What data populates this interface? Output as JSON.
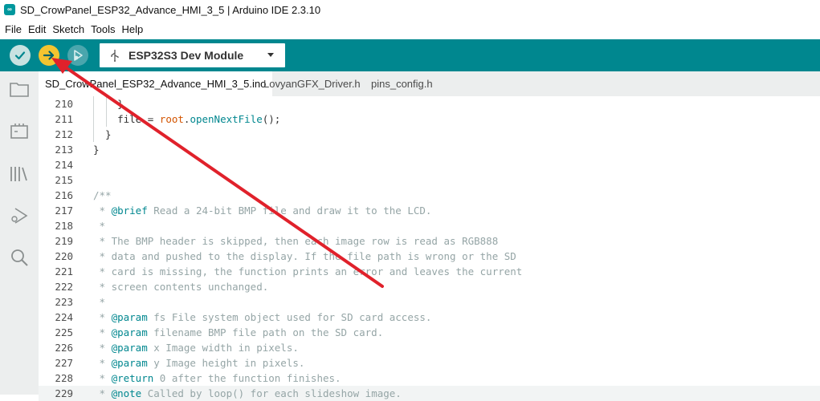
{
  "window": {
    "title": "SD_CrowPanel_ESP32_Advance_HMI_3_5 | Arduino IDE 2.3.10"
  },
  "menu": [
    {
      "label": "File"
    },
    {
      "label": "Edit"
    },
    {
      "label": "Sketch"
    },
    {
      "label": "Tools"
    },
    {
      "label": "Help"
    }
  ],
  "toolbar": {
    "verify_icon": "check-icon",
    "upload_icon": "arrow-right-icon",
    "debug_icon": "debug-icon",
    "board": "ESP32S3 Dev Module",
    "colors": {
      "toolbar_bg": "#00878f",
      "upload": "#f4c430"
    }
  },
  "sidebar": [
    {
      "icon": "folder-icon"
    },
    {
      "icon": "board-icon"
    },
    {
      "icon": "library-icon"
    },
    {
      "icon": "debug-icon"
    },
    {
      "icon": "search-icon"
    }
  ],
  "tabs": [
    {
      "label": "SD_CrowPanel_ESP32_Advance_HMI_3_5.ino",
      "active": true
    },
    {
      "label": "LovyanGFX_Driver.h",
      "active": false
    },
    {
      "label": "pins_config.h",
      "active": false
    }
  ],
  "code_lines": [
    {
      "n": "210",
      "text": "    }"
    },
    {
      "n": "211",
      "text": "    file = root.openNextFile();"
    },
    {
      "n": "212",
      "text": "  }"
    },
    {
      "n": "213",
      "text": "}"
    },
    {
      "n": "214",
      "text": ""
    },
    {
      "n": "215",
      "text": ""
    },
    {
      "n": "216",
      "text": "/**"
    },
    {
      "n": "217",
      "text": " * @brief Read a 24-bit BMP file and draw it to the LCD."
    },
    {
      "n": "218",
      "text": " *"
    },
    {
      "n": "219",
      "text": " * The BMP header is skipped, then each image row is read as RGB888"
    },
    {
      "n": "220",
      "text": " * data and pushed to the display. If the file path is wrong or the SD"
    },
    {
      "n": "221",
      "text": " * card is missing, the function prints an error and leaves the current"
    },
    {
      "n": "222",
      "text": " * screen contents unchanged."
    },
    {
      "n": "223",
      "text": " *"
    },
    {
      "n": "224",
      "text": " * @param fs File system object used for SD card access."
    },
    {
      "n": "225",
      "text": " * @param filename BMP file path on the SD card."
    },
    {
      "n": "226",
      "text": " * @param x Image width in pixels."
    },
    {
      "n": "227",
      "text": " * @param y Image height in pixels."
    },
    {
      "n": "228",
      "text": " * @return 0 after the function finishes."
    },
    {
      "n": "229",
      "text": " * @note Called by loop() for each slideshow image."
    }
  ]
}
